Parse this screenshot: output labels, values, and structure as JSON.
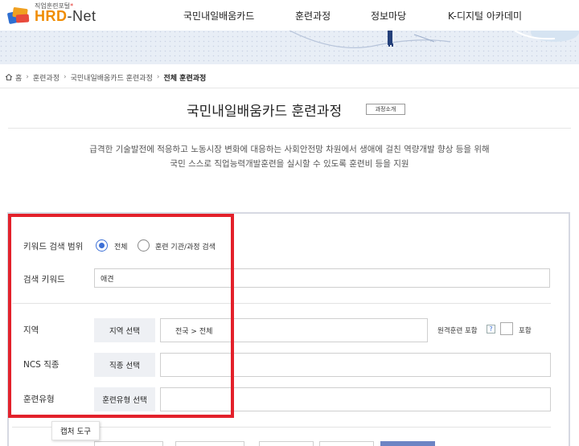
{
  "header": {
    "logo_tag": "직업훈련포털",
    "logo_star": "*",
    "logo_hrd": "HRD",
    "logo_dash": "-",
    "logo_net": "Net",
    "nav": [
      "국민내일배움카드",
      "훈련과정",
      "정보마당",
      "K-디지털 아카데미"
    ]
  },
  "breadcrumb": {
    "home": "홈",
    "items": [
      "훈련과정",
      "국민내일배움카드 훈련과정"
    ],
    "current": "전체 훈련과정"
  },
  "page": {
    "title": "국민내일배움카드 훈련과정",
    "intro_button": "과정소개",
    "desc_line1": "급격한 기술발전에 적응하고 노동시장 변화에 대응하는 사회안전망 차원에서 생애에 걸친 역량개발 향상 등을 위해",
    "desc_line2": "국민 스스로 직업능력개발훈련을 실시할 수 있도록 훈련비 등을 지원"
  },
  "search": {
    "scope_label": "키워드 검색 범위",
    "scope_options": [
      "전체",
      "훈련 기관/과정 검색"
    ],
    "scope_selected": "전체",
    "keyword_label": "검색 키워드",
    "keyword_value": "애견",
    "region_label": "지역",
    "region_button": "지역 선택",
    "region_value": "전국 > 전체",
    "remote_label": "원격훈련 포함",
    "help_mark": "?",
    "include_label": "포함",
    "include_checked": false,
    "ncs_label": "NCS 직종",
    "ncs_button": "직종 선택",
    "ncs_value": "",
    "type_label": "훈련유형",
    "type_button": "훈련유형 선택",
    "type_value": ""
  },
  "tooltip": {
    "text": "캡처 도구"
  },
  "colors": {
    "highlight": "#e3212b",
    "accent": "#3b6fd6",
    "logo_orange": "#f08c00"
  }
}
